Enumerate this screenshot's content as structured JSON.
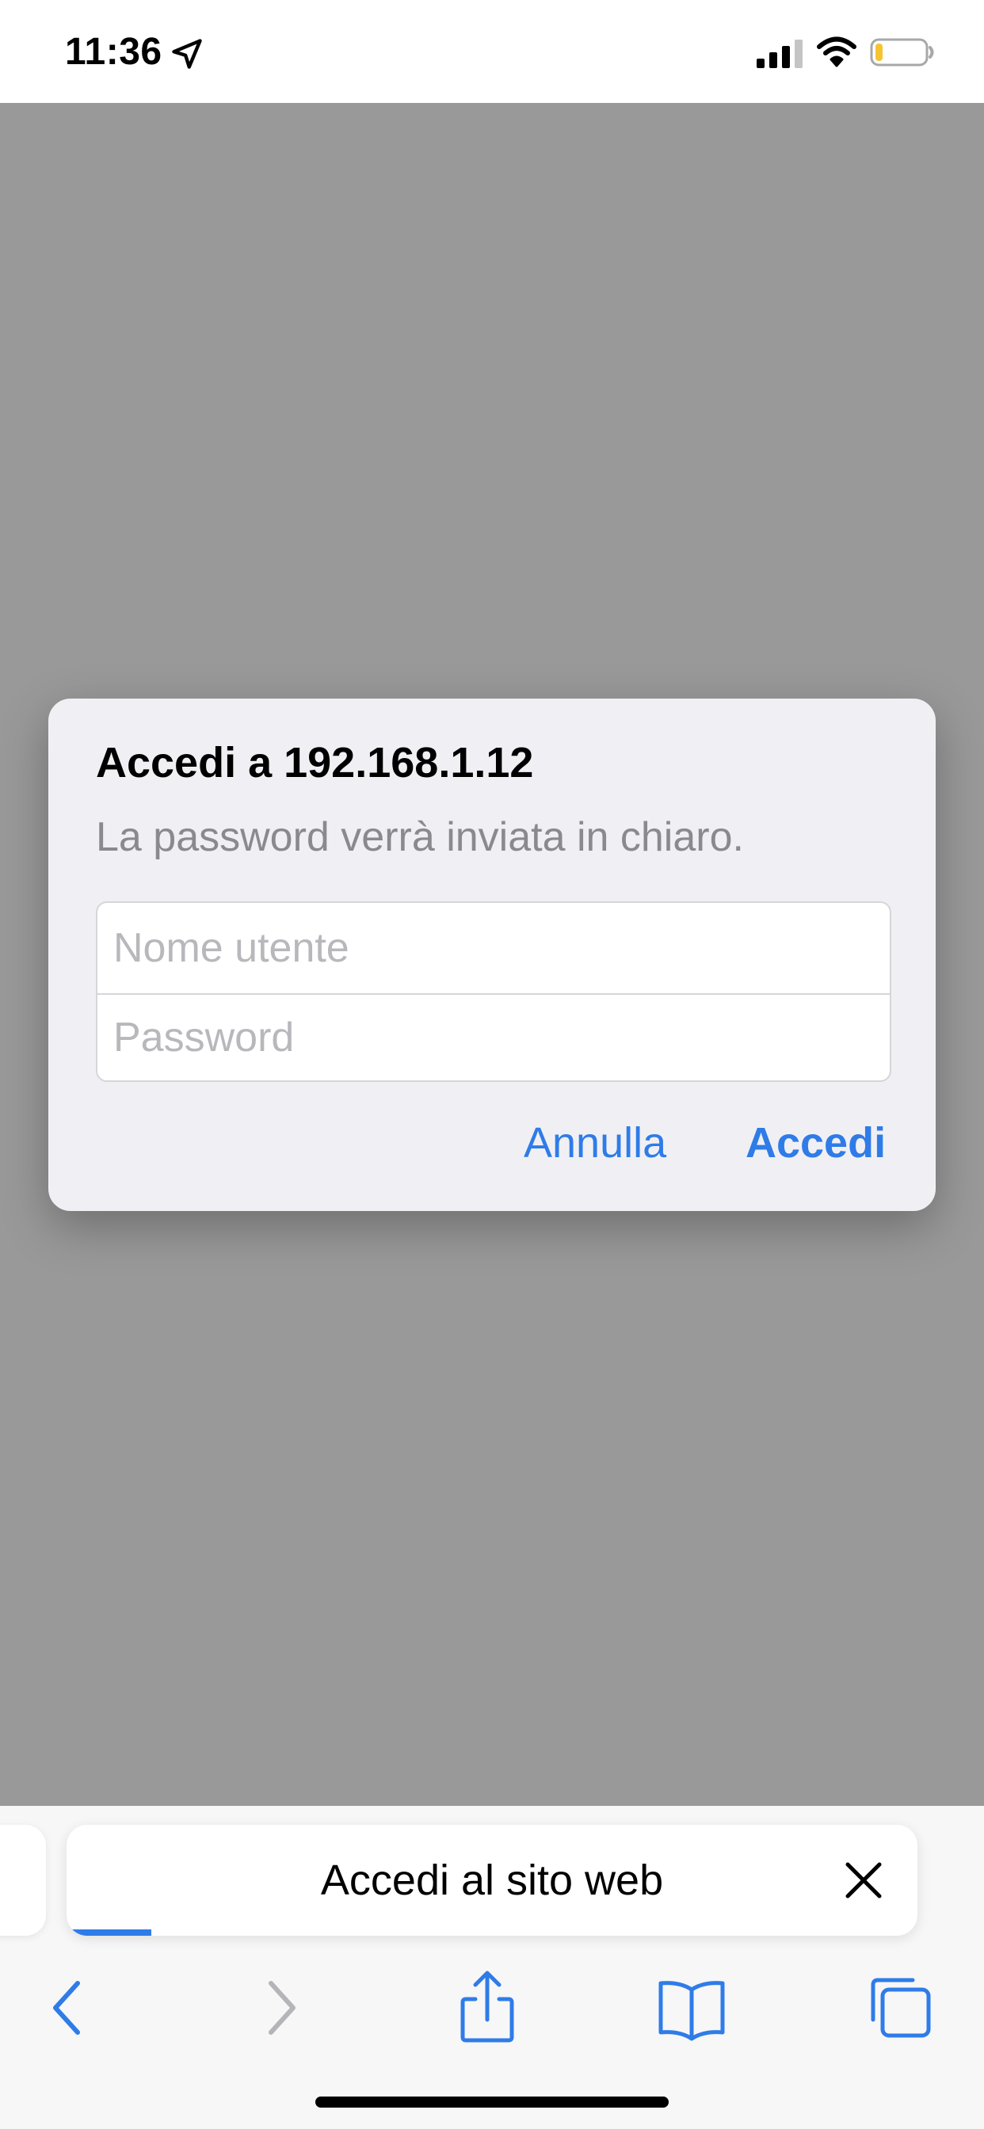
{
  "status_bar": {
    "time": "11:36",
    "location_icon": "location-arrow-icon",
    "signal_icon": "cellular-signal-icon",
    "wifi_icon": "wifi-icon",
    "battery_icon": "battery-low-icon",
    "battery_level": 0.15,
    "battery_color": "#f5c431"
  },
  "alert": {
    "title": "Accedi a 192.168.1.12",
    "message": "La password verrà inviata in chiaro.",
    "username_placeholder": "Nome utente",
    "password_placeholder": "Password",
    "cancel_label": "Annulla",
    "login_label": "Accedi"
  },
  "tab_bar": {
    "title": "Accedi al sito web",
    "close_icon": "close-icon",
    "load_progress": 0.1
  },
  "toolbar": {
    "back_icon": "chevron-left-icon",
    "forward_icon": "chevron-right-icon",
    "share_icon": "share-icon",
    "bookmarks_icon": "book-icon",
    "tabs_icon": "tabs-icon"
  },
  "colors": {
    "accent": "#2f7ce8",
    "dim_background": "#999999",
    "alert_background": "#f0f0f4",
    "disabled_icon": "#b5b5b9"
  }
}
